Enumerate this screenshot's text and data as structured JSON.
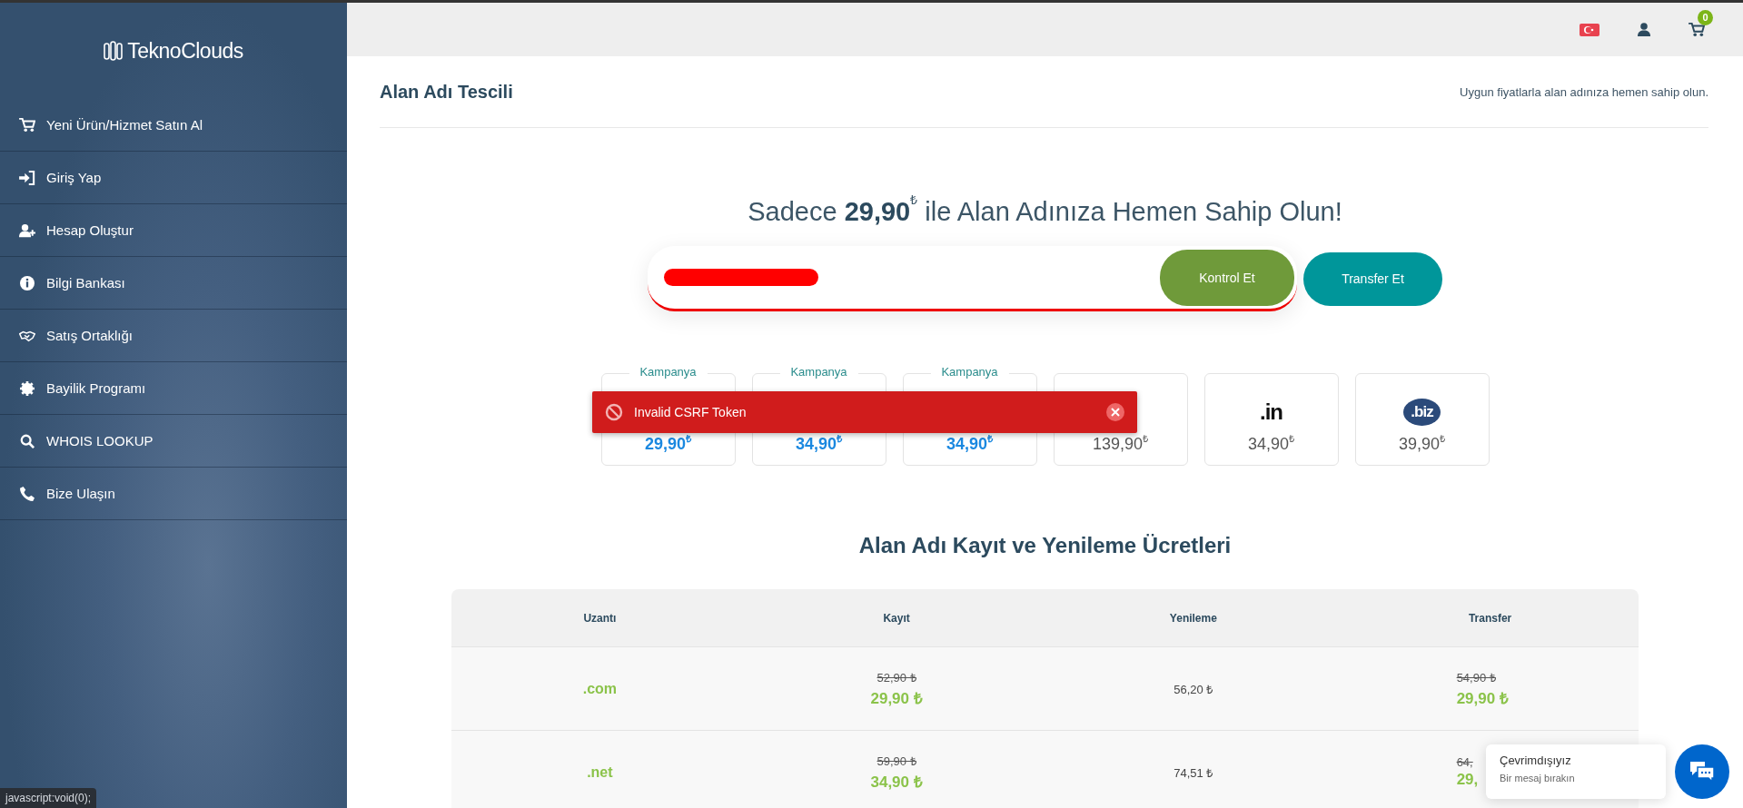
{
  "sidebar": {
    "logo": "TeknoClouds",
    "items": [
      {
        "label": "Yeni Ürün/Hizmet Satın Al",
        "kind": "cart"
      },
      {
        "label": "Giriş Yap",
        "kind": "sign-in"
      },
      {
        "label": "Hesap Oluştur",
        "kind": "user-plus"
      },
      {
        "label": "Bilgi Bankası",
        "kind": "info"
      },
      {
        "label": "Satış Ortaklığı",
        "kind": "handshake"
      },
      {
        "label": "Bayilik Programı",
        "kind": "gear"
      },
      {
        "label": "WHOIS LOOKUP",
        "kind": "search"
      },
      {
        "label": "Bize Ulaşın",
        "kind": "phone"
      }
    ]
  },
  "top_bar": {
    "cart_count": "0"
  },
  "page_header": {
    "title": "Alan Adı Tescili",
    "subtitle": "Uygun fiyatlarla alan adınıza hemen sahip olun."
  },
  "hero": {
    "headline": "Sadece  **29,90**$^{₺}$  ile Alan Adınıza Hemen Sahip Olun!"
  },
  "search": {
    "buttons": [
      {
        "label": "Kontrol Et",
        "kind": "check"
      },
      {
        "label": "Transfer Et",
        "kind": "transfer"
      }
    ]
  },
  "tld_cards": [
    {
      "price": "29,90$^{₺}$",
      "promo": true,
      "badge": "Kampanya"
    },
    {
      "price": "34,90$^{₺}$",
      "promo": true,
      "badge": "Kampanya"
    },
    {
      "price": "34,90$^{₺}$",
      "promo": true,
      "badge": "Kampanya"
    },
    {
      "price": "139,90$^{₺}$",
      "promo": false
    },
    {
      "tld": ".in",
      "price": "34,90$^{₺}$",
      "promo": false,
      "color": "#111111"
    },
    {
      "tld": ".biz",
      "price": "39,90$^{₺}$",
      "promo": false,
      "color": "#2b4a7a"
    }
  ],
  "toast": {
    "message": "Invalid CSRF Token"
  },
  "price_table": {
    "title": "Alan Adı Kayıt ve Yenileme Ücretleri",
    "columns": [
      "Uzantı",
      "Kayıt",
      "Yenileme",
      "Transfer"
    ],
    "rows": [
      {
        "tld": ".com",
        "register_old": "52,90 ₺",
        "register": "29,90 ₺",
        "renew": "56,20 ₺",
        "transfer_old": "54,90 ₺",
        "transfer": "29,90 ₺"
      },
      {
        "tld": ".net",
        "register_old": "59,90 ₺",
        "register": "34,90 ₺",
        "renew": "74,51 ₺",
        "transfer_old": "64,",
        "transfer": "29,"
      }
    ]
  },
  "chat": {
    "status": "Çevrimdışıyız",
    "prompt": "Bir mesaj bırakın"
  },
  "status_bar": {
    "url": "javascript:void(0);"
  }
}
